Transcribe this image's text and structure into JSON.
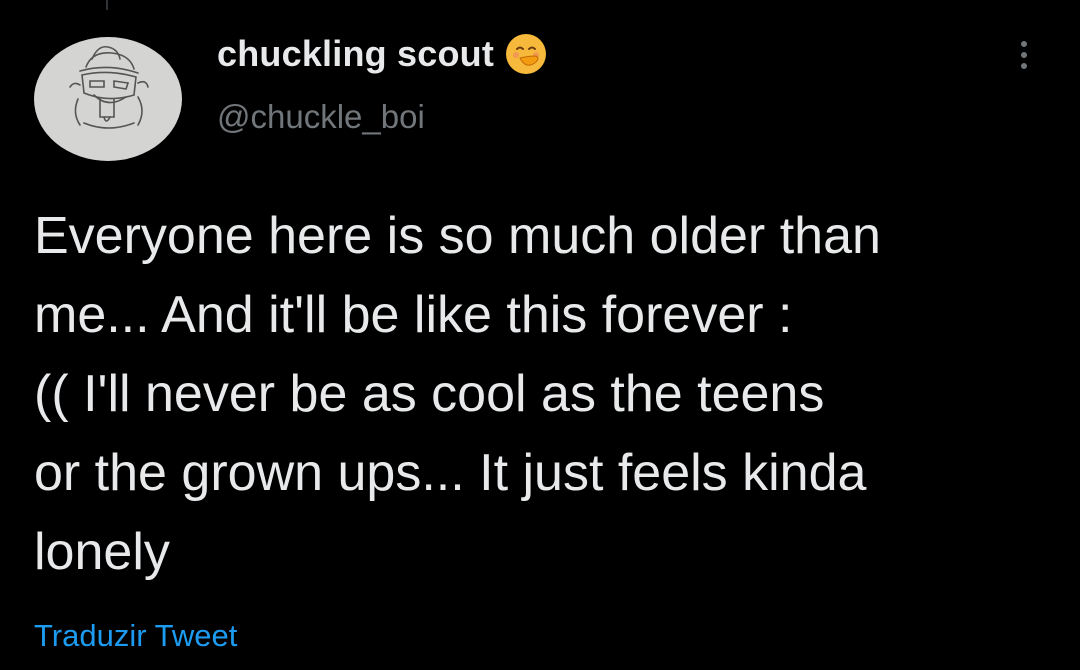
{
  "author": {
    "display_name": "chuckling scout",
    "handle": "@chuckle_boi",
    "badge_icon": "face-with-hand-over-mouth-emoji",
    "avatar_icon": "sketched-character-avatar"
  },
  "tweet": {
    "text_lines": [
      "Everyone here is so much older than",
      "me... And it'll be like this forever :",
      "(( I'll never be as cool as the teens",
      "or the grown ups... It just feels kinda",
      "lonely"
    ]
  },
  "actions": {
    "translate_label": "Traduzir Tweet",
    "more_icon": "more-options-icon"
  },
  "colors": {
    "background": "#000000",
    "primary_text": "#e7e9ea",
    "secondary_text": "#71767b",
    "link": "#1d9bf0"
  }
}
